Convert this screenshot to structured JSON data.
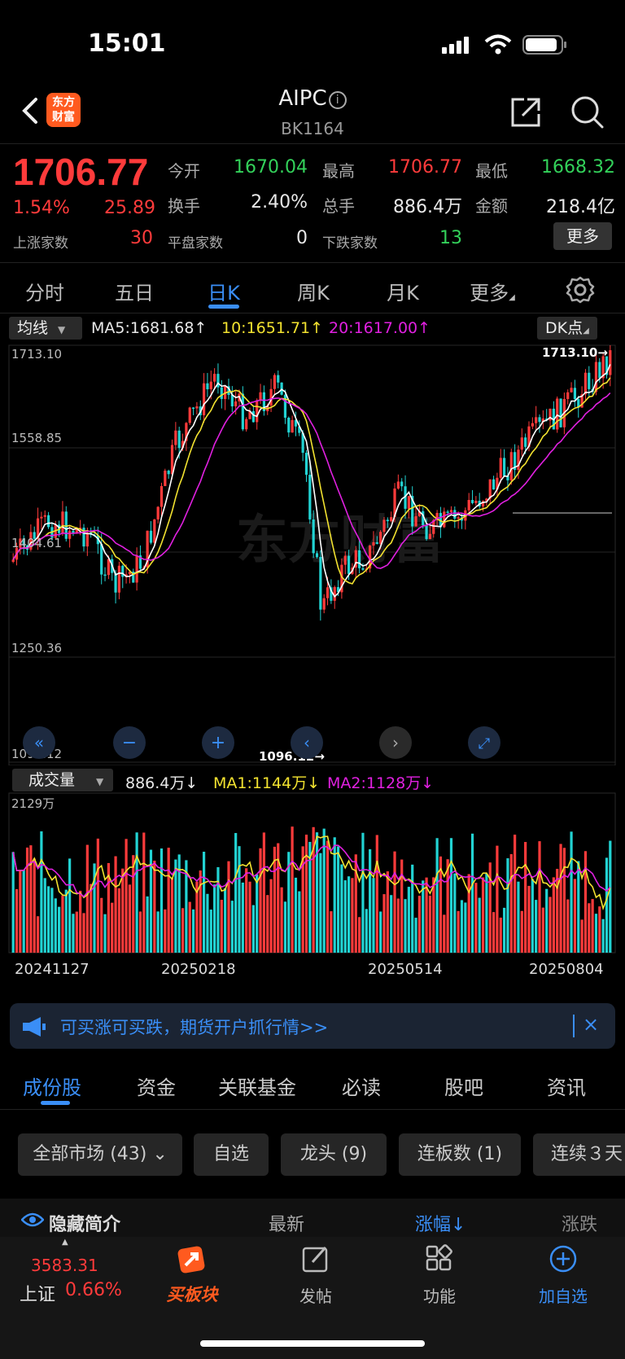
{
  "status": {
    "time": "15:01"
  },
  "nav": {
    "title": "AIPC",
    "subtitle": "BK1164",
    "logo": "东方\n财富"
  },
  "quote": {
    "price": "1706.77",
    "pct": "1.54%",
    "change": "25.89",
    "open_label": "今开",
    "open": "1670.04",
    "high_label": "最高",
    "high": "1706.77",
    "low_label": "最低",
    "low": "1668.32",
    "turnover_label": "换手",
    "turnover": "2.40%",
    "volume_label": "总手",
    "volume": "886.4万",
    "amount_label": "金额",
    "amount": "218.4亿",
    "up_label": "上涨家数",
    "up": "30",
    "flat_label": "平盘家数",
    "flat": "0",
    "down_label": "下跌家数",
    "down": "13",
    "more": "更多"
  },
  "chart_tabs": [
    "分时",
    "五日",
    "日K",
    "周K",
    "月K",
    "更多"
  ],
  "ma": {
    "selector": "均线",
    "ma5": "MA5:1681.68↑",
    "ma10": "10:1651.71↑",
    "ma20": "20:1617.00↑",
    "dk": "DK点"
  },
  "chart_data": {
    "type": "candlestick",
    "price_axis": [
      "1713.10",
      "1558.85",
      "1404.61",
      "1250.36",
      "1096.12"
    ],
    "max_label": "1713.10→",
    "min_label": "1096.12→",
    "x_labels": [
      "20241127",
      "20250218",
      "20250514",
      "20250804"
    ],
    "volume_label": "2129万",
    "ylim": [
      1096.12,
      1713.1
    ],
    "colors": {
      "up": "#ff3b3b",
      "down": "#22d3d3",
      "ma5": "#ffffff",
      "ma10": "#f2e230",
      "ma20": "#e020e0"
    }
  },
  "volume": {
    "selector": "成交量",
    "vol": "886.4万↓",
    "ma1": "MA1:1144万↓",
    "ma2": "MA2:1128万↓"
  },
  "banner": {
    "text": "可买涨可买跌，期货开户抓行情>>",
    "close": "×"
  },
  "sub_tabs": [
    "成份股",
    "资金",
    "关联基金",
    "必读",
    "股吧",
    "资讯"
  ],
  "chips": [
    "全部市场 (43) ⌄",
    "自选",
    "龙头 (9)",
    "连板数 (1)",
    "连续３天"
  ],
  "list_header": {
    "toggle": "隐藏简介",
    "latest": "最新",
    "pct": "涨幅↓",
    "chg": "涨跌"
  },
  "bottom": {
    "index_value": "3583.31",
    "index_name": "上证",
    "index_pct": "0.66%",
    "buy": "买板块",
    "post": "发帖",
    "func": "功能",
    "add": "加自选"
  }
}
